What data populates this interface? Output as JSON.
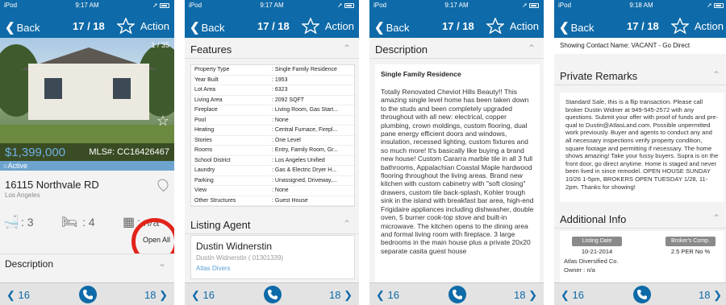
{
  "colors": {
    "nav_blue": "#0e6aa8",
    "price_blue": "#6fb0e8",
    "active_bar": "#6da4cf",
    "annotation_red": "#e2231a"
  },
  "screens": [
    {
      "status": {
        "carrier": "iPod",
        "time": "9:17 AM"
      },
      "nav": {
        "back": "Back",
        "counter": "17 / 18",
        "action": "Action"
      },
      "bottom": {
        "prev": "16",
        "next": "18"
      },
      "photo_count": "1 / 35",
      "price": "$1,399,000",
      "mls": "MLS#: CC16426467",
      "status_label": "Active",
      "address": "16115 Northvale RD",
      "city": "Los Angeles",
      "baths": ": 3",
      "beds": ": 4",
      "sqft": ": n/a",
      "open_all": "Open All",
      "description_label": "Description"
    },
    {
      "status": {
        "carrier": "iPod",
        "time": "9:17 AM"
      },
      "nav": {
        "back": "Back",
        "counter": "17 / 18",
        "action": "Action"
      },
      "bottom": {
        "prev": "16",
        "next": "18"
      },
      "features_title": "Features",
      "features": [
        {
          "label": "Property Type",
          "value": ": Single Family Residence"
        },
        {
          "label": "Year Built",
          "value": ": 1953"
        },
        {
          "label": "Lot Area",
          "value": ": 6323"
        },
        {
          "label": "Living Area",
          "value": ": 2092 SQFT"
        },
        {
          "label": "Fireplace",
          "value": ": Living Room, Gas Start..."
        },
        {
          "label": "Pool",
          "value": ": None"
        },
        {
          "label": "Heating",
          "value": ": Central Furnace, Firepl..."
        },
        {
          "label": "Stories",
          "value": ": One Level"
        },
        {
          "label": "Rooms",
          "value": ": Entry, Family Room, Gr..."
        },
        {
          "label": "School District",
          "value": ": Los Angeles Unified"
        },
        {
          "label": "Laundry",
          "value": ": Gas & Electric Dryer H..."
        },
        {
          "label": "Parking",
          "value": ": Unassigned, Driveway,..."
        },
        {
          "label": "View",
          "value": ": None"
        },
        {
          "label": "Other Structures",
          "value": ": Guest House"
        }
      ],
      "agent_title": "Listing Agent",
      "agent_name": "Dustin Widnerstin",
      "agent_id": "Dustin Widnerstin ( 01301339)",
      "agent_company": "Atlas Divers"
    },
    {
      "status": {
        "carrier": "iPod",
        "time": "9:17 AM"
      },
      "nav": {
        "back": "Back",
        "counter": "17 / 18",
        "action": "Action"
      },
      "bottom": {
        "prev": "16",
        "next": "18"
      },
      "desc_title": "Description",
      "desc_heading": "Single Family Residence",
      "desc_body": "Totally Renovated Cheviot Hills Beauty!! This amazing single level home has been taken down to the studs and been completely upgraded throughout with all new: electrical, copper plumbing, crown moldings, custom flooring, dual pane energy efficient doors and windows, insulation, recessed lighting, custom fixtures and so much more! It's basically like buying a brand new house! Custom Cararra marble tile in all 3 full bathrooms, Appalachian Coastal Maple hardwood flooring throughout the living areas. Brand new kitchen with custom cabinetry with \"soft closing\" drawers, custom tile back-splash, Kohler trough sink in the island with breakfast bar area, high-end Frigidaire appliances including dishwasher, double oven, 5 burner cook-top stove and built-in microwave. The kitchen opens to the dining area and formal living room with fireplace. 3 large bedrooms in the main house plus a private 20x20 separate casita guest house"
    },
    {
      "status": {
        "carrier": "iPod",
        "time": "9:18 AM"
      },
      "nav": {
        "back": "Back",
        "counter": "17 / 18",
        "action": "Action"
      },
      "bottom": {
        "prev": "16",
        "next": "18"
      },
      "showing_contact": "Showing Contact Name: VACANT - Go Direct",
      "remarks_title": "Private Remarks",
      "remarks_body": "Standard Sale, this is a flip transaction. Please call broker Dustin Widner at 949-545-2572 with any questions. Submit your offer with proof of funds and pre-qual to Dustin@AtlasLand.com. Possible unpermitted work previously. Buyer and agents to conduct any and all necessary inspections verify property condition, square footage and permitting if necessary. The home shows amazing! Take your fussy buyers. Supra is on the front door, go direct anytime. Home is staged and never been lived in since remodel. OPEN HOUSE SUNDAY 10/26 1-5pm, BROKERS OPEN TUESDAY 1/28, 11-2pm. Thanks for showing!",
      "additional_title": "Additional Info",
      "listing_date_label": "Listing Date",
      "listing_date": "10-21-2014",
      "brokers_comp_label": "Broker's Comp.",
      "brokers_comp": "2.5 PER No %",
      "company": "Atlas Diversified Co.",
      "owner": "Owner : n/a"
    }
  ]
}
